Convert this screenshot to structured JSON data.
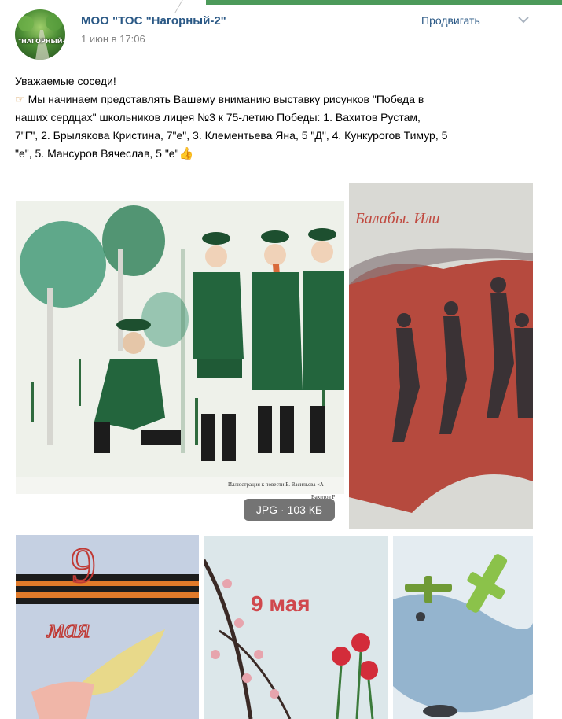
{
  "post": {
    "group_name": "МОО \"ТОС \"Нагорный-2\"",
    "date": "1 июн в 17:06",
    "avatar_text": "\"НАГОРНЫЙ-2\"",
    "promote_label": "Продвигать",
    "text_lines": [
      "Уважаемые соседи!",
      "Мы начинаем представлять Вашему вниманию выставку рисунков \"Победа в",
      "наших сердцах\" школьников лицея №3 к 75-летию Победы: 1. Вахитов Рустам,",
      "7\"Г\", 2. Брылякова Кристина, 7\"е\", 3. Клементьева Яна, 5 \"Д\", 4. Кункурогов Тимур, 5",
      "\"е\", 5. Мансуров Вячеслав, 5 \"е\""
    ]
  },
  "attachments": {
    "badge": "JPG · 103 КБ",
    "caption_1": "Иллюстрация к повести Б. Васильева «А",
    "caption_2": "Вахитов Р",
    "drawing_2_text": "Балабы. Или",
    "drawing_4_text": "9 мая",
    "drawing_3_text": "9 мая"
  },
  "icons": {
    "pointer": "pointing-hand-icon",
    "thumbs_up": "thumbs-up-icon",
    "chevron": "chevron-down-icon"
  },
  "colors": {
    "link": "#2a5885",
    "meta": "#828282",
    "accent_green": "#4c9a5a"
  }
}
